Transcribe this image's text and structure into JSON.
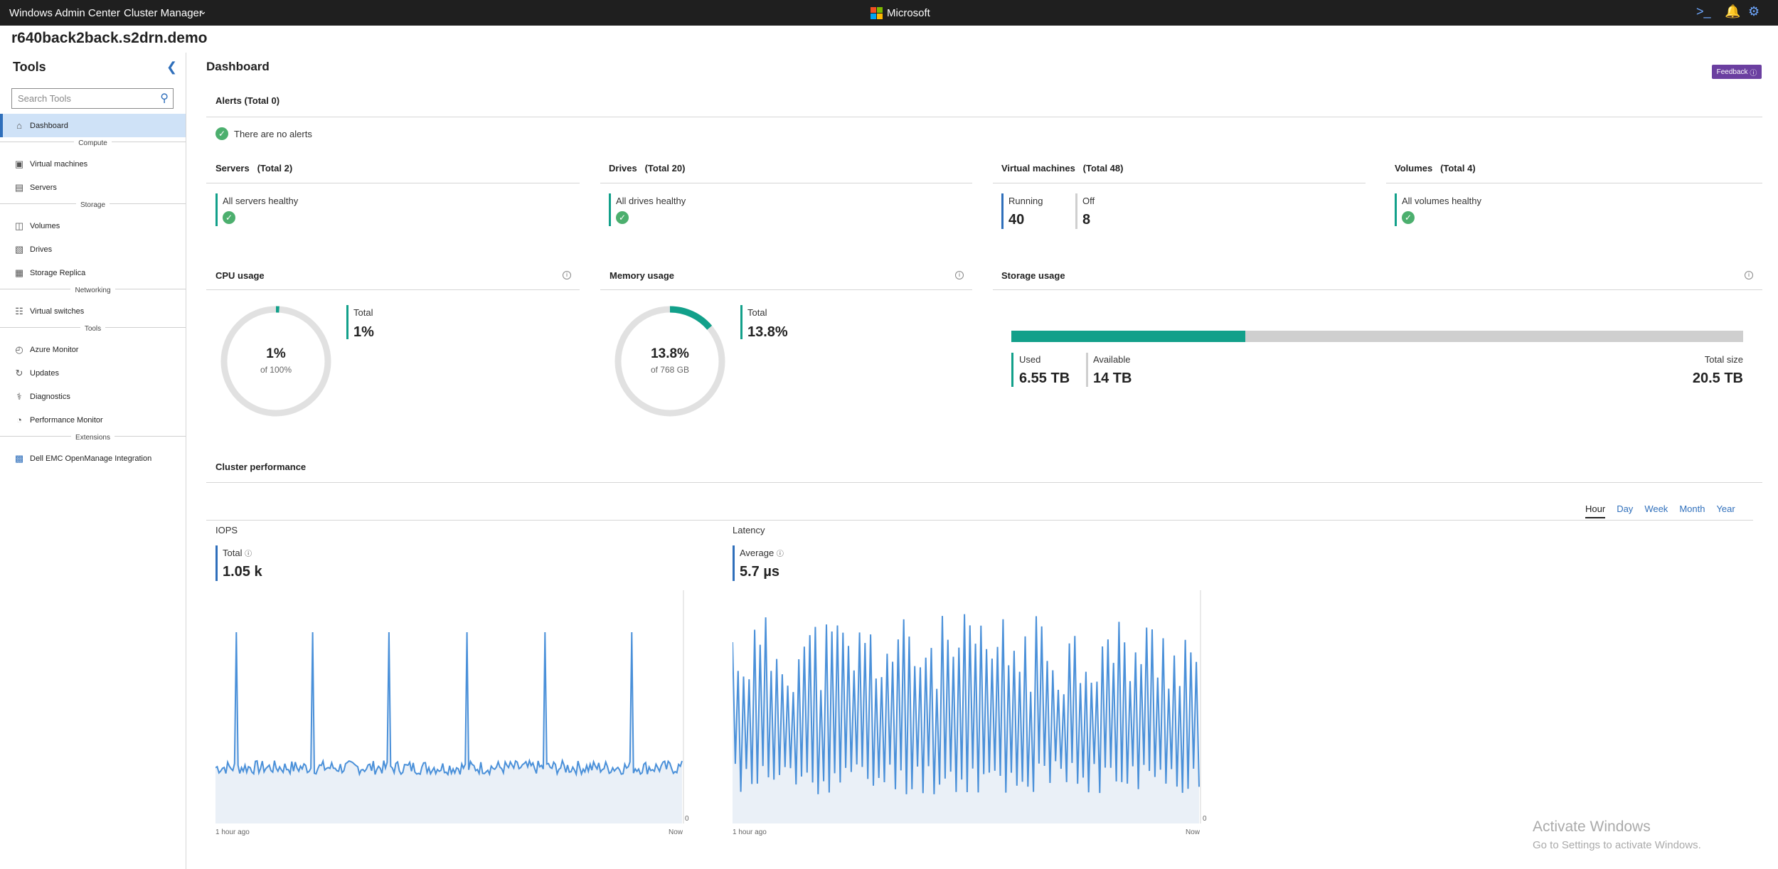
{
  "topbar": {
    "app_title": "Windows Admin Center",
    "manager": "Cluster Manager",
    "brand": "Microsoft",
    "icons": [
      "powershell-icon",
      "notifications-icon",
      "settings-icon"
    ]
  },
  "host": "r640back2back.s2drn.demo",
  "sidebar": {
    "title": "Tools",
    "search_placeholder": "Search Tools",
    "sections": [
      {
        "label": "",
        "items": [
          {
            "label": "Dashboard",
            "icon": "home-icon",
            "active": true
          }
        ]
      },
      {
        "label": "Compute",
        "items": [
          {
            "label": "Virtual machines",
            "icon": "vm-icon"
          },
          {
            "label": "Servers",
            "icon": "server-icon"
          }
        ]
      },
      {
        "label": "Storage",
        "items": [
          {
            "label": "Volumes",
            "icon": "volume-icon"
          },
          {
            "label": "Drives",
            "icon": "drive-icon"
          },
          {
            "label": "Storage Replica",
            "icon": "replica-icon"
          }
        ]
      },
      {
        "label": "Networking",
        "items": [
          {
            "label": "Virtual switches",
            "icon": "switch-icon"
          }
        ]
      },
      {
        "label": "Tools",
        "items": [
          {
            "label": "Azure Monitor",
            "icon": "azure-monitor-icon"
          },
          {
            "label": "Updates",
            "icon": "updates-icon"
          },
          {
            "label": "Diagnostics",
            "icon": "diagnostics-icon"
          },
          {
            "label": "Performance Monitor",
            "icon": "perfmon-icon"
          }
        ]
      },
      {
        "label": "Extensions",
        "items": [
          {
            "label": "Dell EMC OpenManage Integration",
            "icon": "dell-icon"
          }
        ]
      }
    ]
  },
  "main": {
    "title": "Dashboard",
    "feedback": "Feedback",
    "alerts": {
      "title": "Alerts (Total 0)",
      "message": "There are no alerts"
    },
    "servers": {
      "title": "Servers",
      "total": "(Total 2)",
      "status": "All servers healthy"
    },
    "drives": {
      "title": "Drives",
      "total": "(Total 20)",
      "status": "All drives healthy"
    },
    "vms": {
      "title": "Virtual machines",
      "total": "(Total 48)",
      "running_label": "Running",
      "running": "40",
      "off_label": "Off",
      "off": "8"
    },
    "volumes": {
      "title": "Volumes",
      "total": "(Total 4)",
      "status": "All volumes healthy"
    },
    "cpu": {
      "title": "CPU usage",
      "value": "1%",
      "sub": "of 100%",
      "total_label": "Total",
      "total": "1%",
      "percent": 1
    },
    "memory": {
      "title": "Memory usage",
      "value": "13.8%",
      "sub": "of 768 GB",
      "total_label": "Total",
      "total": "13.8%",
      "percent": 13.8
    },
    "storage": {
      "title": "Storage usage",
      "used_label": "Used",
      "used": "6.55 TB",
      "available_label": "Available",
      "available": "14 TB",
      "total_label": "Total size",
      "total": "20.5 TB",
      "used_fraction": 0.32
    },
    "performance": {
      "title": "Cluster performance",
      "time_tabs": [
        "Hour",
        "Day",
        "Week",
        "Month",
        "Year"
      ],
      "active_tab": "Hour",
      "iops": {
        "title": "IOPS",
        "metric_label": "Total",
        "value": "1.05 k",
        "x_start": "1 hour ago",
        "x_end": "Now",
        "y_zero": "0"
      },
      "latency": {
        "title": "Latency",
        "metric_label": "Average",
        "value": "5.7 µs",
        "x_start": "1 hour ago",
        "x_end": "Now",
        "y_zero": "0"
      }
    },
    "watermark": {
      "line1": "Activate Windows",
      "line2": "Go to Settings to activate Windows."
    }
  },
  "colors": {
    "accent": "#2f6fbb",
    "teal": "#12a08a",
    "healthy": "#4caf6e",
    "chart_line": "#4a90d9",
    "chart_fill": "#eaf0f7",
    "feedback": "#6b3fa0"
  }
}
